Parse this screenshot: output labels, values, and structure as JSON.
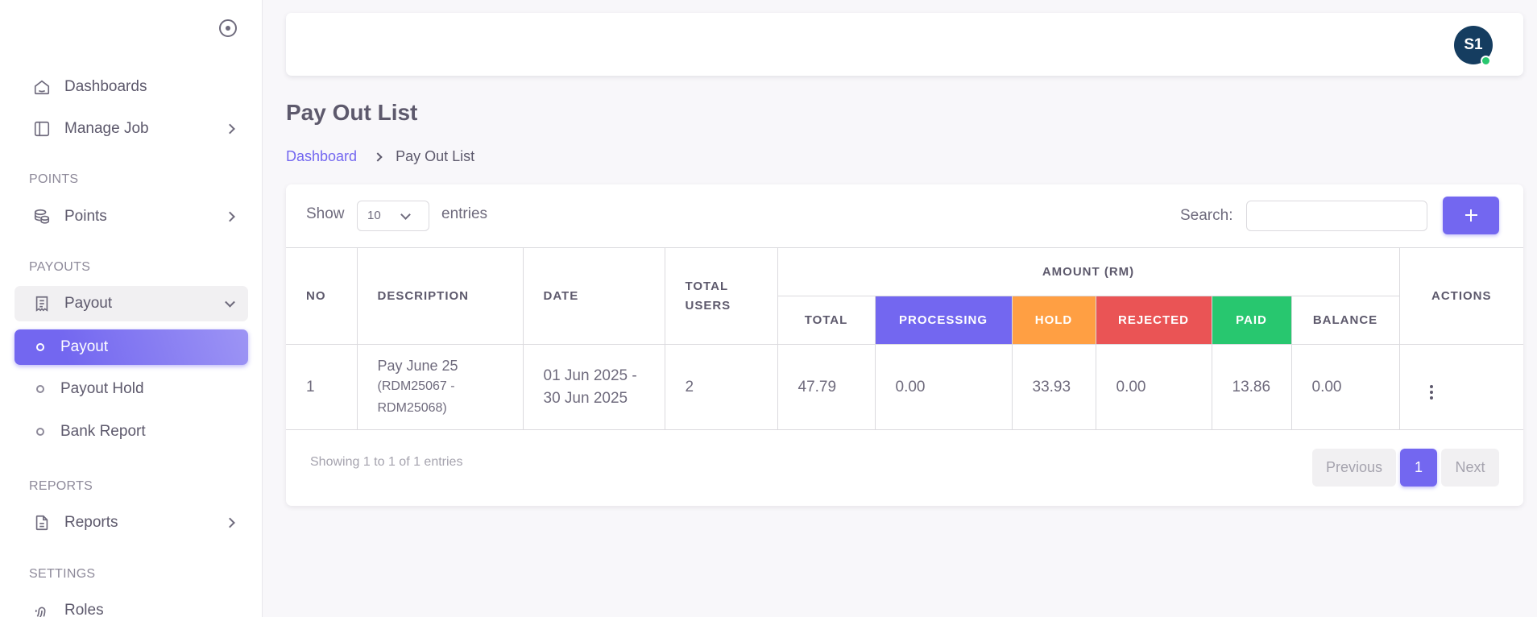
{
  "sidebar": {
    "items": [
      {
        "label": "Dashboards",
        "icon": "home-icon"
      },
      {
        "label": "Manage Job",
        "icon": "layout-sidebar-icon"
      }
    ],
    "sections": [
      {
        "title": "POINTS",
        "items": [
          {
            "label": "Points",
            "icon": "coins-icon"
          }
        ]
      },
      {
        "title": "PAYOUTS",
        "items": [
          {
            "label": "Payout",
            "icon": "receipt-icon",
            "expanded": true,
            "children": [
              "Payout",
              "Payout Hold",
              "Bank Report"
            ]
          }
        ]
      },
      {
        "title": "REPORTS",
        "items": [
          {
            "label": "Reports",
            "icon": "file-text-icon"
          }
        ]
      },
      {
        "title": "SETTINGS",
        "items": [
          {
            "label": "Roles",
            "icon": "fingerprint-icon"
          }
        ]
      }
    ]
  },
  "topbar": {
    "avatar_initials": "S1",
    "status_color": "#28c76f"
  },
  "page": {
    "title": "Pay Out List",
    "breadcrumb": {
      "link": "Dashboard",
      "current": "Pay Out List"
    }
  },
  "table_controls": {
    "show_label": "Show",
    "page_length": "10",
    "entries_label": "entries",
    "search_label": "Search:",
    "search_value": ""
  },
  "table": {
    "headers": {
      "no": "NO",
      "description": "DESCRIPTION",
      "date": "DATE",
      "total_users": "TOTAL USERS",
      "amount_group": "AMOUNT (RM)",
      "total": "TOTAL",
      "processing": "PROCESSING",
      "hold": "HOLD",
      "rejected": "REJECTED",
      "paid": "PAID",
      "balance": "BALANCE",
      "actions": "ACTIONS"
    },
    "rows": [
      {
        "no": "1",
        "description": "Pay June 25",
        "description_sub": "(RDM25067 - RDM25068)",
        "date": "01 Jun 2025 - 30 Jun 2025",
        "total_users": "2",
        "total": "47.79",
        "processing": "0.00",
        "hold": "33.93",
        "rejected": "0.00",
        "paid": "13.86",
        "balance": "0.00"
      }
    ]
  },
  "footer": {
    "info": "Showing 1 to 1 of 1 entries",
    "prev": "Previous",
    "current_page": "1",
    "next": "Next"
  },
  "colors": {
    "primary": "#7367f0",
    "processing": "#7367f0",
    "hold": "#ff9f43",
    "rejected": "#ea5455",
    "paid": "#28c76f"
  }
}
